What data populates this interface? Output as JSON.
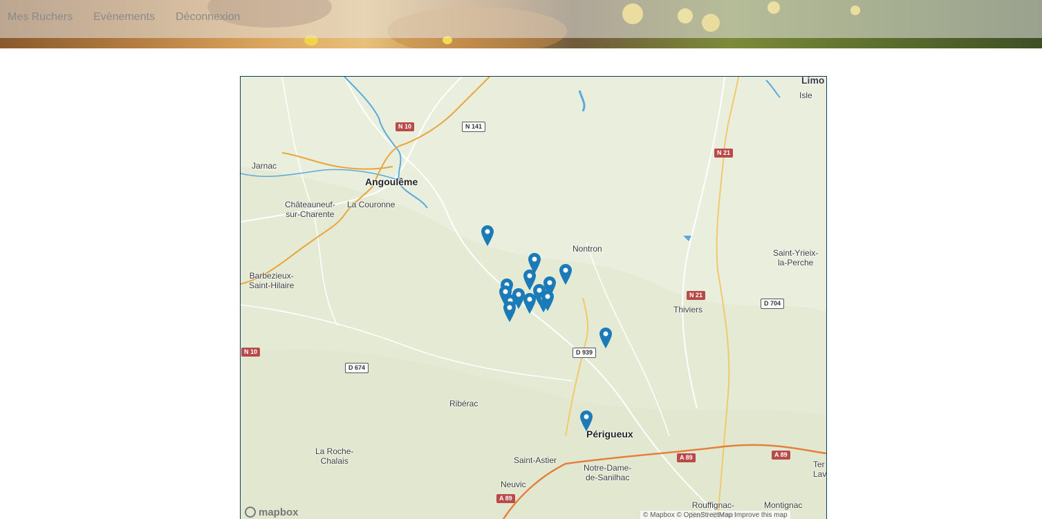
{
  "nav": {
    "items": [
      {
        "label": "Mes Ruchers"
      },
      {
        "label": "Evènements"
      },
      {
        "label": "Déconnexion"
      }
    ]
  },
  "colors": {
    "marker": "#1a7bb8",
    "river": "#5aa9dd",
    "road_primary": "#e9a53a",
    "road_motorway": "#e57f3c",
    "land": "#e9eedd"
  },
  "map": {
    "places": [
      {
        "name": "Limo"
      },
      {
        "name": "Isle"
      },
      {
        "name": "Jarnac"
      },
      {
        "name": "Angoulême"
      },
      {
        "name": "Châteauneuf-\nsur-Charente"
      },
      {
        "name": "La Couronne"
      },
      {
        "name": "Nontron"
      },
      {
        "name": "Saint-Yrieix-\nla-Perche"
      },
      {
        "name": "Barbezieux-\nSaint-Hilaire"
      },
      {
        "name": "Thiviers"
      },
      {
        "name": "Ribérac"
      },
      {
        "name": "Périgueux"
      },
      {
        "name": "La Roche-\nChalais"
      },
      {
        "name": "Saint-Astier"
      },
      {
        "name": "Notre-Dame-\nde-Sanilhac"
      },
      {
        "name": "Neuvic"
      },
      {
        "name": "Rouffignac-\nSaint-Cernin"
      },
      {
        "name": "Montignac"
      },
      {
        "name": "Ter\nLav"
      }
    ],
    "road_shields": [
      {
        "label": "N 10",
        "style": "red"
      },
      {
        "label": "N 141",
        "style": "white"
      },
      {
        "label": "N 21",
        "style": "red"
      },
      {
        "label": "N 21",
        "style": "red"
      },
      {
        "label": "D 704",
        "style": "white"
      },
      {
        "label": "N 10",
        "style": "red"
      },
      {
        "label": "D 674",
        "style": "white"
      },
      {
        "label": "D 939",
        "style": "white"
      },
      {
        "label": "A 89",
        "style": "red"
      },
      {
        "label": "A 89",
        "style": "red"
      },
      {
        "label": "A 89",
        "style": "red"
      }
    ],
    "marker_count": 16,
    "logo_text": "mapbox",
    "attribution": "© Mapbox © OpenStreetMap Improve this map"
  }
}
